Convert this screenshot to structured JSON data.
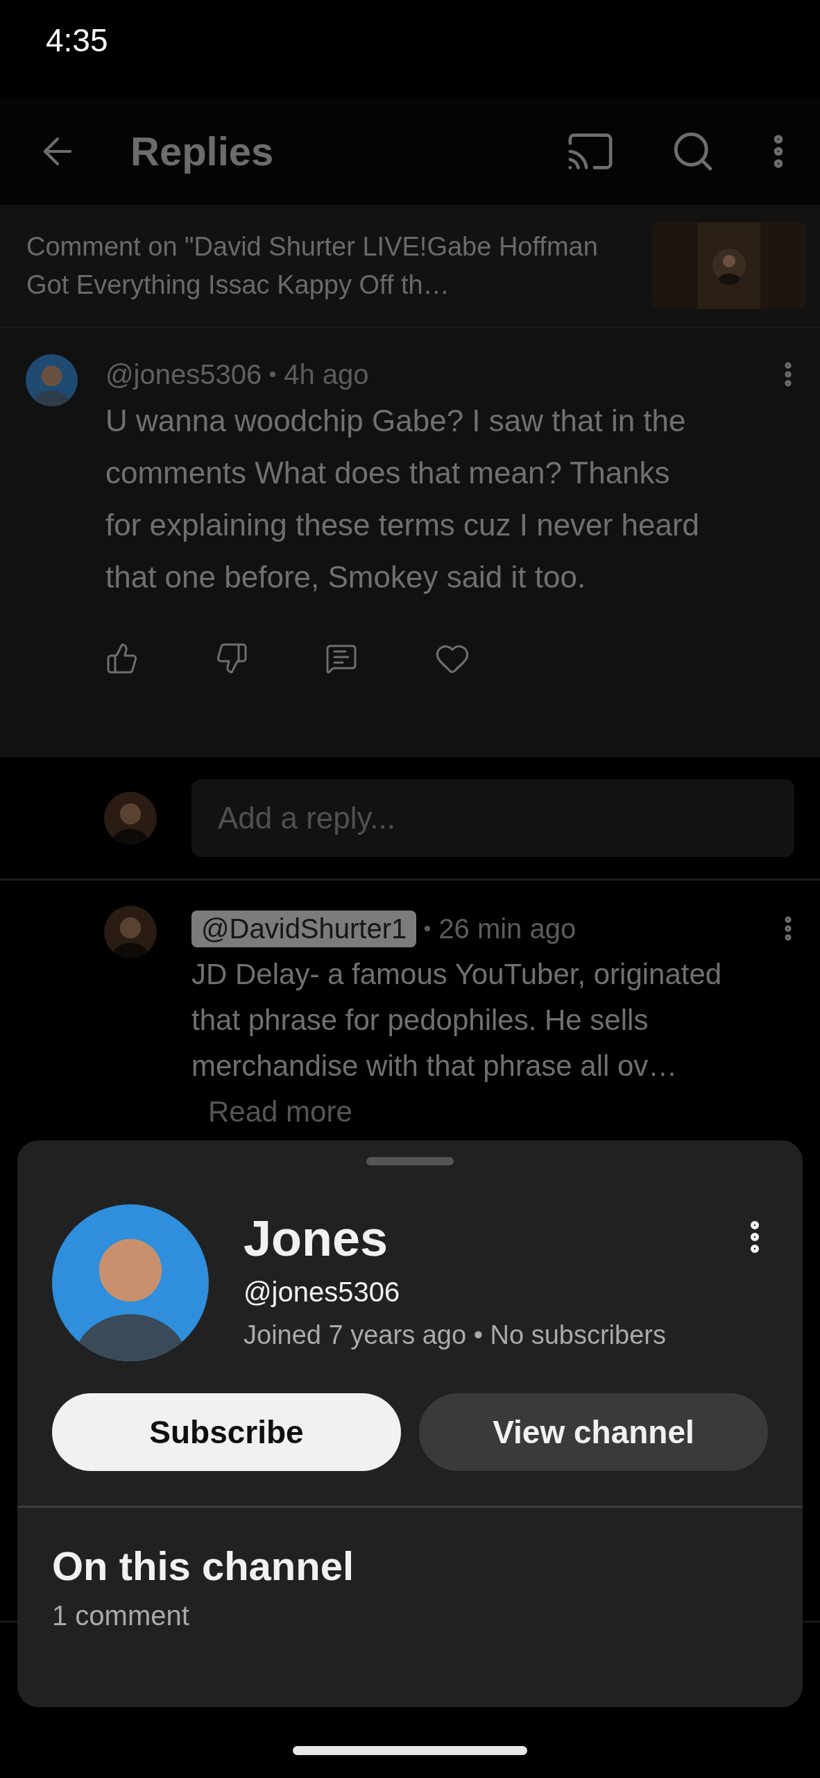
{
  "status_bar": {
    "time": "4:35"
  },
  "app_bar": {
    "title": "Replies"
  },
  "context": {
    "text": "Comment on \"David Shurter LIVE!Gabe Hoffman Got Everything Issac Kappy Off th…"
  },
  "comment": {
    "author": "@jones5306",
    "highlighted": false,
    "time": "4h ago",
    "text": "U wanna woodchip Gabe? I saw that in the comments What does that mean? Thanks for explaining these terms cuz I never heard that one before, Smokey said it too."
  },
  "reply_field": {
    "placeholder": "Add a reply..."
  },
  "replies": [
    {
      "author": "@DavidShurter1",
      "highlighted": true,
      "time": "26 min ago",
      "text": "JD Delay- a famous YouTuber, originated that phrase for pedophiles. He sells merchandise with that phrase all ov…",
      "read_more": "Read more"
    }
  ],
  "channel_sheet": {
    "name": "Jones",
    "handle": "@jones5306",
    "meta": "Joined 7 years ago • No subscribers",
    "buttons": [
      {
        "label": "Subscribe",
        "kind": "primary"
      },
      {
        "label": "View channel",
        "kind": "secondary"
      }
    ],
    "section_title": "On this channel",
    "section_count": "1 comment"
  }
}
